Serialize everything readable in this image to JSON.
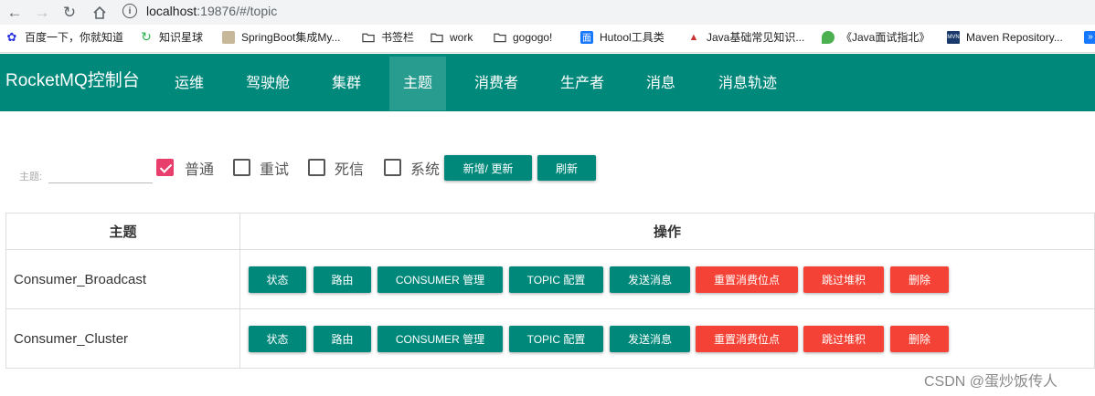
{
  "browser": {
    "url_host": "localhost",
    "url_rest": ":19876/#/topic",
    "bookmarks": [
      {
        "icon": "baidu-icon",
        "label": "百度一下，你就知道"
      },
      {
        "icon": "circle-arrow-icon",
        "label": "知识星球"
      },
      {
        "icon": "avatar-icon",
        "label": "SpringBoot集成My..."
      },
      {
        "icon": "folder-icon",
        "label": "书签栏"
      },
      {
        "icon": "folder-icon",
        "label": "work"
      },
      {
        "icon": "folder-icon",
        "label": "gogogo!"
      },
      {
        "icon": "hutool-icon",
        "label": "Hutool工具类"
      },
      {
        "icon": "java-icon",
        "label": "Java基础常见知识..."
      },
      {
        "icon": "leaf-icon",
        "label": "《Java面试指北》"
      },
      {
        "icon": "maven-icon",
        "label": "Maven Repository..."
      }
    ]
  },
  "header": {
    "brand": "RocketMQ控制台",
    "nav": [
      "运维",
      "驾驶舱",
      "集群",
      "主题",
      "消费者",
      "生产者",
      "消息",
      "消息轨迹"
    ],
    "active": "主题"
  },
  "filter": {
    "topic_label": "主题:",
    "topic_value": "",
    "checkboxes": [
      {
        "label": "普通",
        "checked": true
      },
      {
        "label": "重试",
        "checked": false
      },
      {
        "label": "死信",
        "checked": false
      },
      {
        "label": "系统",
        "checked": false
      }
    ],
    "add_update_label": "新增/ 更新",
    "refresh_label": "刷新"
  },
  "table": {
    "headers": [
      "主题",
      "操作"
    ],
    "rows": [
      {
        "topic": "Consumer_Broadcast"
      },
      {
        "topic": "Consumer_Cluster"
      }
    ],
    "actions": [
      {
        "label": "状态",
        "color": "#00897b"
      },
      {
        "label": "路由",
        "color": "#00897b"
      },
      {
        "label": "CONSUMER 管理",
        "color": "#00897b"
      },
      {
        "label": "TOPIC 配置",
        "color": "#00897b"
      },
      {
        "label": "发送消息",
        "color": "#00897b"
      },
      {
        "label": "重置消费位点",
        "color": "#f44336"
      },
      {
        "label": "跳过堆积",
        "color": "#f44336"
      },
      {
        "label": "删除",
        "color": "#f44336"
      }
    ]
  },
  "watermark": "CSDN @蛋炒饭传人",
  "colors": {
    "primary": "#00897b",
    "danger": "#f44336",
    "checkbox": "#e83e6c"
  }
}
